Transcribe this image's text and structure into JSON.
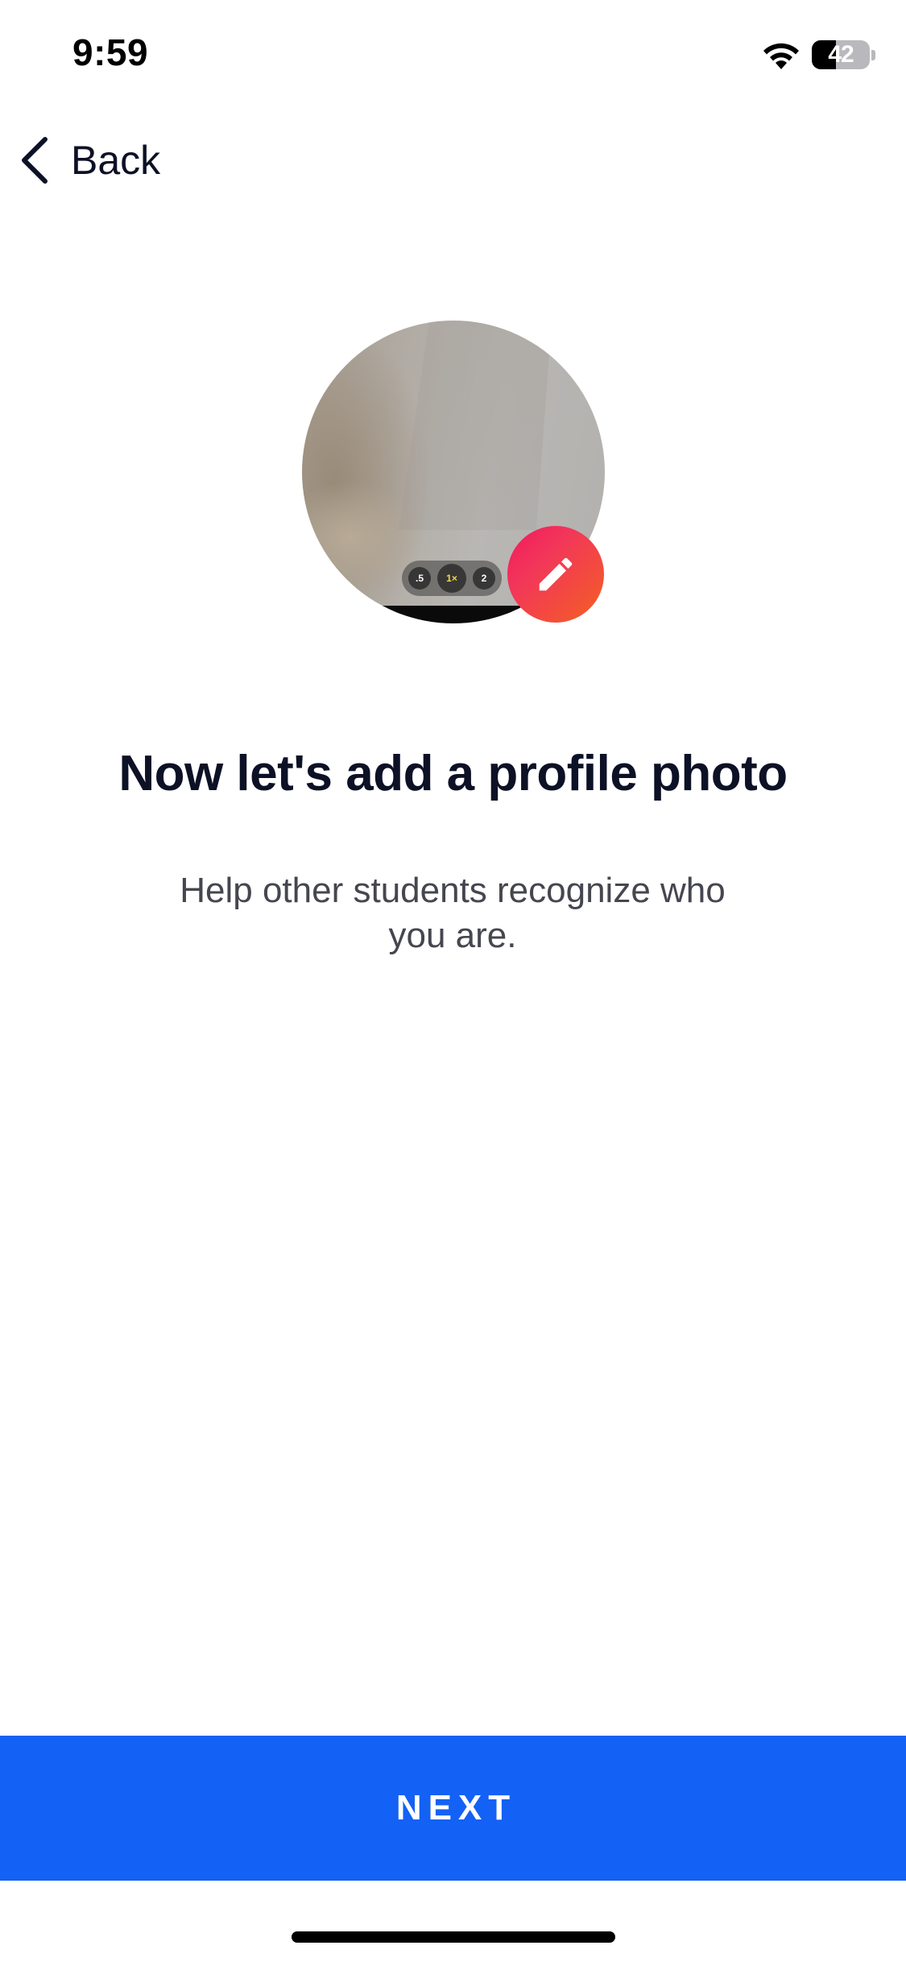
{
  "status_bar": {
    "time": "9:59",
    "battery_level": "42",
    "icons": [
      "wifi-icon",
      "battery-icon"
    ]
  },
  "nav": {
    "back_label": "Back",
    "back_icon": "chevron-left-icon"
  },
  "avatar": {
    "zoom_options": [
      ".5",
      "1×",
      "2"
    ],
    "selected_zoom": "1×",
    "edit_icon": "pencil-icon",
    "edit_gradient": [
      "#f01a5c",
      "#f46022"
    ]
  },
  "content": {
    "title": "Now let's add a profile photo",
    "subtitle": "Help other students recognize who you are."
  },
  "footer": {
    "next_label": "NEXT",
    "accent_color": "#1461f5"
  }
}
